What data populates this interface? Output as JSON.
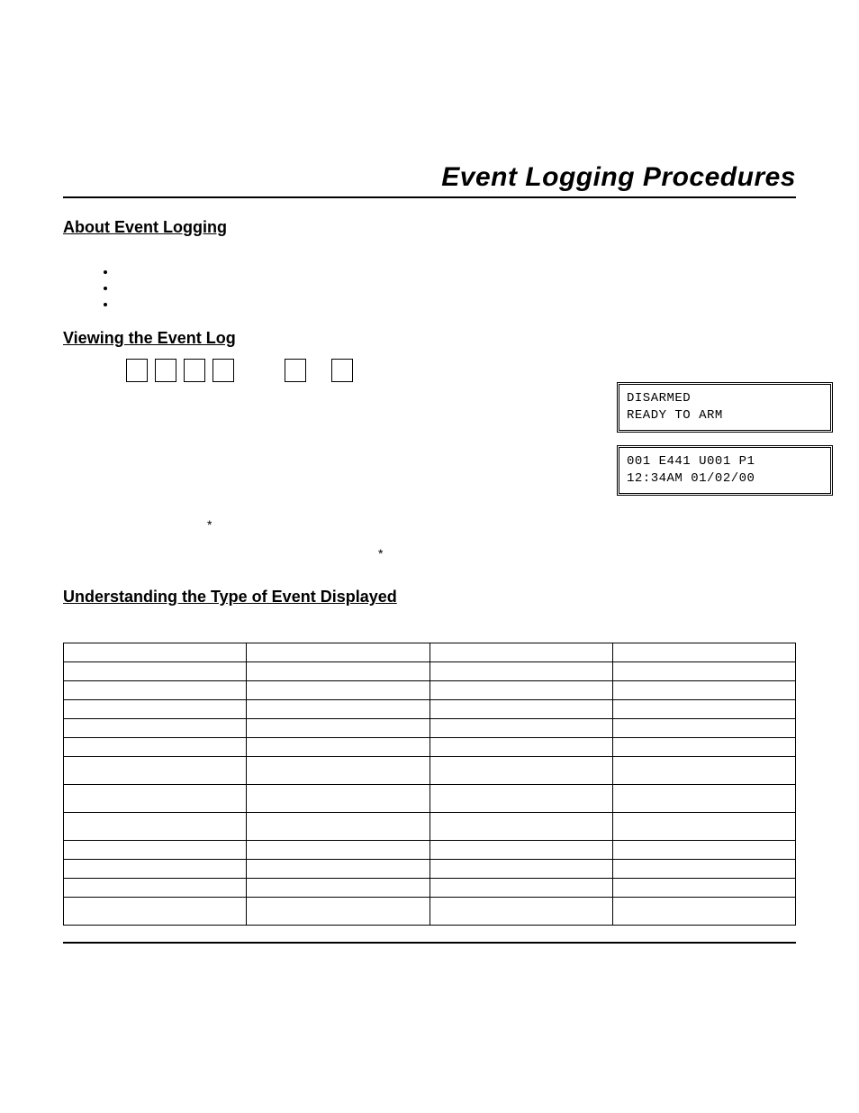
{
  "title": "Event Logging Procedures",
  "sections": {
    "about": "About Event Logging",
    "viewing": "Viewing the Event Log",
    "understanding": "Understanding the Type of Event Displayed"
  },
  "bullets": [
    "",
    "",
    ""
  ],
  "displays": {
    "box1_line1": "DISARMED",
    "box1_line2": "READY TO ARM",
    "box2_line1": "001 E441 U001 P1",
    "box2_line2": "12:34AM 01/02/00"
  },
  "stars": {
    "s1": "*",
    "s2": "*"
  },
  "table": {
    "cols": 4,
    "rows": 13
  }
}
